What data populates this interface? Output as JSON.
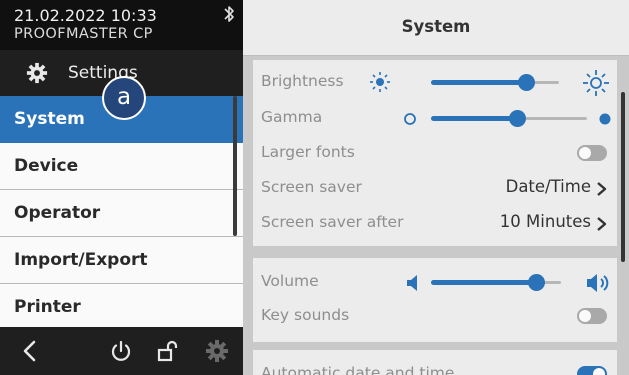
{
  "status": {
    "datetime": "21.02.2022 10:33",
    "device": "PROOFMASTER CP",
    "bluetooth_icon": "bluetooth-icon"
  },
  "sidebar": {
    "settings_label": "Settings",
    "marker": "a",
    "items": [
      {
        "label": "System",
        "active": true
      },
      {
        "label": "Device"
      },
      {
        "label": "Operator"
      },
      {
        "label": "Import/Export"
      },
      {
        "label": "Printer"
      }
    ],
    "footer_icons": [
      "back-icon",
      "power-icon",
      "unlock-icon",
      "gear-icon"
    ]
  },
  "header": {
    "title": "System"
  },
  "display": {
    "brightness": {
      "label": "Brightness",
      "value": 0.74
    },
    "gamma": {
      "label": "Gamma",
      "value": 0.55
    },
    "larger_fonts": {
      "label": "Larger fonts",
      "on": false
    },
    "screen_saver": {
      "label": "Screen saver",
      "value": "Date/Time"
    },
    "screen_saver_after": {
      "label": "Screen saver after",
      "value": "10 Minutes"
    }
  },
  "sound": {
    "volume": {
      "label": "Volume",
      "value": 0.81
    },
    "key_sounds": {
      "label": "Key sounds",
      "on": false
    }
  },
  "datetime_section": {
    "auto_label": "Automatic date and time",
    "on": true
  },
  "colors": {
    "accent": "#2a73b8",
    "sidebar_bg": "#1f1f1f",
    "panel_bg": "#ececec"
  }
}
